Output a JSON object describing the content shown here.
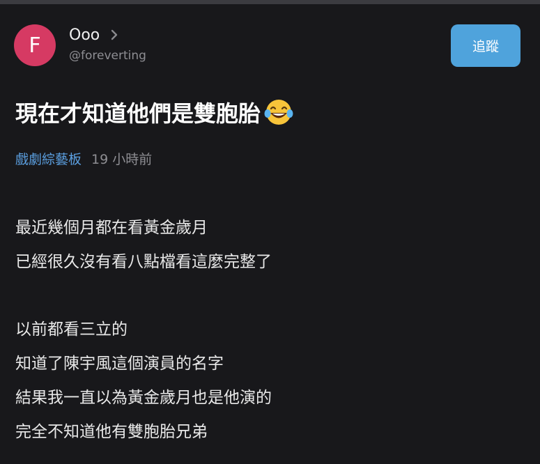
{
  "colors": {
    "avatar_bg": "#d63a63",
    "follow_bg": "#4fa3dc",
    "board_link": "#5b9fe0"
  },
  "author": {
    "avatar_letter": "F",
    "name": "Ooo",
    "chevron_icon": "chevron-right-icon",
    "handle": "@foreverting"
  },
  "follow_button": {
    "label": "追蹤"
  },
  "post": {
    "title": "現在才知道他們是雙胞胎",
    "title_emoji": "face-with-tears-of-joy-icon",
    "board": "戲劇綜藝板",
    "time": "19 小時前",
    "body_lines": [
      "最近幾個月都在看黃金歲月",
      "已經很久沒有看八點檔看這麼完整了",
      "",
      "以前都看三立的",
      "知道了陳宇風這個演員的名字",
      "結果我一直以為黃金歲月也是他演的",
      "完全不知道他有雙胞胎兄弟"
    ]
  }
}
